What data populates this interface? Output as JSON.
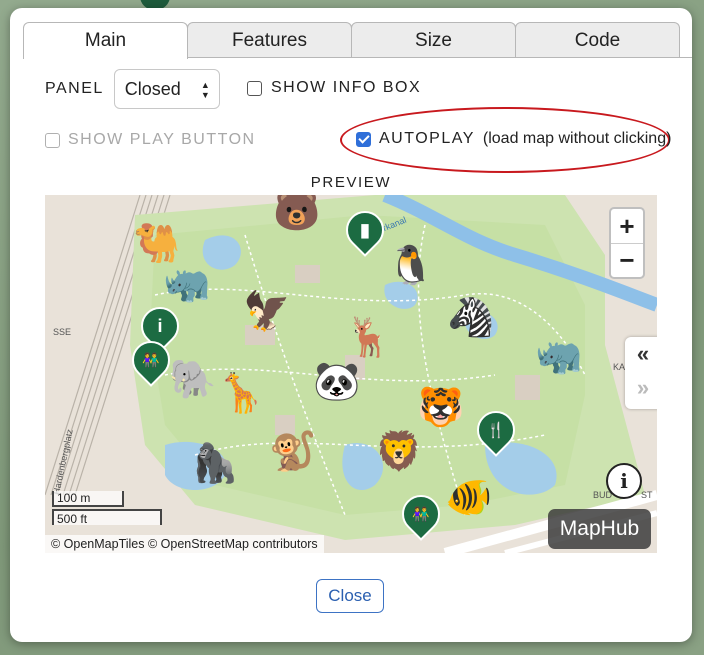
{
  "tabs": [
    {
      "label": "Main",
      "active": true
    },
    {
      "label": "Features",
      "active": false
    },
    {
      "label": "Size",
      "active": false
    },
    {
      "label": "Code",
      "active": false
    }
  ],
  "panel": {
    "label": "PANEL",
    "value": "Closed"
  },
  "show_info_box": {
    "label": "SHOW INFO BOX",
    "checked": false
  },
  "show_play_button": {
    "label": "SHOW PLAY BUTTON",
    "checked": false,
    "disabled": true
  },
  "autoplay": {
    "label": "AUTOPLAY",
    "sub": "(load map without clicking)",
    "checked": true
  },
  "highlight_color": "#c8191e",
  "preview": {
    "label": "PREVIEW",
    "zoom_in": "+",
    "zoom_out": "−",
    "collapse_icon": "«",
    "expand_icon": "»",
    "info_icon": "i",
    "brand": "MapHub",
    "scale_metric": "100 m",
    "scale_imperial": "500 ft",
    "attribution": "© OpenMapTiles © OpenStreetMap contributors",
    "street_labels": [
      "Hardenbergplatz",
      "SSE",
      "ehrkanal",
      "KA",
      "BUD",
      "ST"
    ],
    "markers": [
      {
        "name": "camel-icon",
        "glyph": "🐫"
      },
      {
        "name": "bear-icon",
        "glyph": "🐻"
      },
      {
        "name": "penguin-icon",
        "glyph": "🐧"
      },
      {
        "name": "rhino-icon",
        "glyph": "🦏"
      },
      {
        "name": "eagle-icon",
        "glyph": "🦅"
      },
      {
        "name": "deer-icon",
        "glyph": "🦌"
      },
      {
        "name": "zebra-icon",
        "glyph": "🦓"
      },
      {
        "name": "rhino-icon-2",
        "glyph": "🦏"
      },
      {
        "name": "elephant-icon",
        "glyph": "🐘"
      },
      {
        "name": "giraffe-icon",
        "glyph": "🦒"
      },
      {
        "name": "panda-icon",
        "glyph": "🐼"
      },
      {
        "name": "tiger-icon",
        "glyph": "🐯"
      },
      {
        "name": "gorilla-icon",
        "glyph": "🦍"
      },
      {
        "name": "monkey-icon",
        "glyph": "🐒"
      },
      {
        "name": "lion-icon",
        "glyph": "🦁"
      },
      {
        "name": "fish-icon",
        "glyph": "🐠"
      }
    ],
    "pins": [
      {
        "name": "drinking-water-pin-icon",
        "glyph": "▮"
      },
      {
        "name": "info-pin-icon",
        "glyph": "i"
      },
      {
        "name": "restroom-pin-icon",
        "glyph": "👫"
      },
      {
        "name": "restaurant-pin-icon",
        "glyph": "🍴"
      },
      {
        "name": "restroom-pin-icon-2",
        "glyph": "👫"
      }
    ]
  },
  "close_label": "Close"
}
